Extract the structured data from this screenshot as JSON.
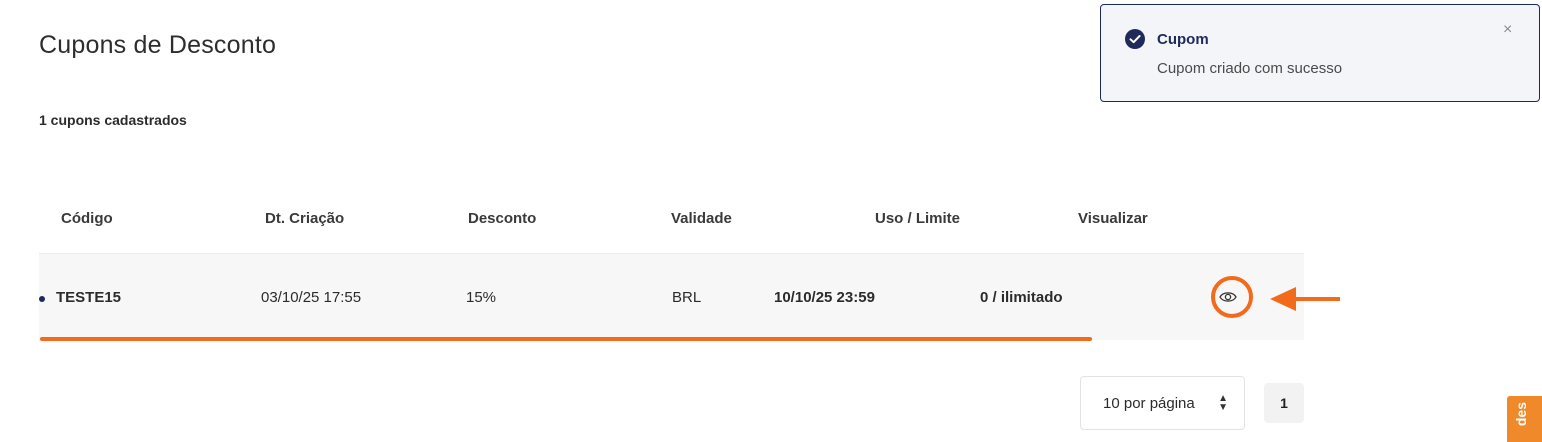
{
  "page": {
    "title": "Cupons de Desconto",
    "count_text": "1 cupons cadastrados"
  },
  "table": {
    "headers": [
      "Código",
      "Dt. Criação",
      "Desconto",
      "Validade",
      "Uso / Limite",
      "Visualizar"
    ],
    "rows": [
      {
        "code": "TESTE15",
        "created": "03/10/25 17:55",
        "discount": "15%",
        "currency": "BRL",
        "validity": "10/10/25 23:59",
        "usage": "0 / ilimitado",
        "view_icon": "eye-icon"
      }
    ]
  },
  "pagination": {
    "per_page_label": "10 por página",
    "current_page": "1"
  },
  "side_tab": {
    "label": "des"
  },
  "toast": {
    "title": "Cupom",
    "message": "Cupom criado com sucesso",
    "close_symbol": "×",
    "icon": "check-circle-icon"
  },
  "colors": {
    "accent": "#f26a1b",
    "primary": "#1f2a5a",
    "side_tab": "#f0892a"
  }
}
